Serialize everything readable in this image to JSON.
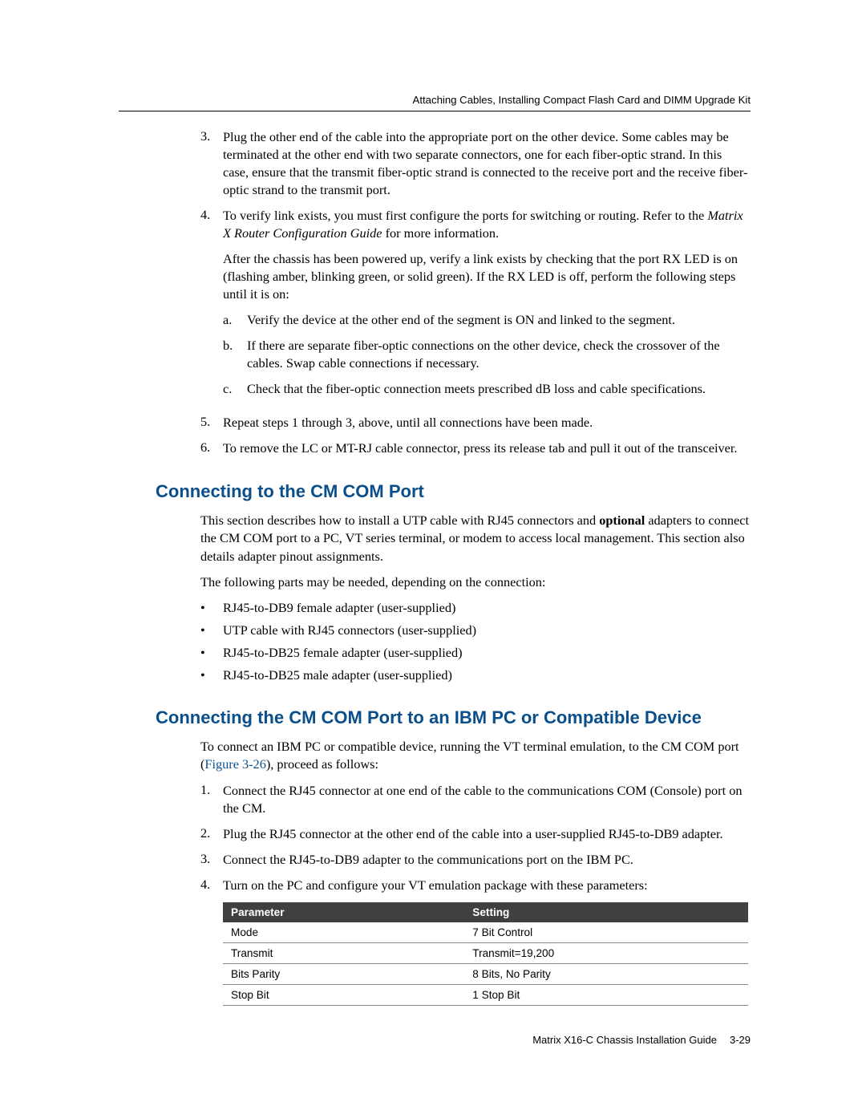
{
  "header": {
    "running_title": "Attaching Cables, Installing Compact Flash Card and DIMM Upgrade Kit"
  },
  "steps_first": {
    "i3": {
      "num": "3.",
      "text": "Plug the other end of the cable into the appropriate port on the other device. Some cables may be terminated at the other end with two separate connectors, one for each fiber-optic strand. In this case, ensure that the transmit fiber-optic strand is connected to the receive port and the receive fiber-optic strand to the transmit port."
    },
    "i4": {
      "num": "4.",
      "lead": "To verify link exists, you must first configure the ports for switching or routing. Refer to the ",
      "ital": "Matrix X Router Configuration Guide",
      "tail": " for more information.",
      "sub_para": "After the chassis has been powered up, verify a link exists by checking that the port RX LED is on (flashing amber, blinking green, or solid green). If the RX LED is off, perform the following steps until it is on:",
      "a": {
        "lbl": "a.",
        "text": "Verify the device at the other end of the segment is ON and linked to the segment."
      },
      "b": {
        "lbl": "b.",
        "text": "If there are separate fiber-optic connections on the other device, check the crossover of the cables. Swap cable connections if necessary."
      },
      "c": {
        "lbl": "c.",
        "text": "Check that the fiber-optic connection meets prescribed dB loss and cable specifications."
      }
    },
    "i5": {
      "num": "5.",
      "text": "Repeat steps 1 through 3, above, until all connections have been made."
    },
    "i6": {
      "num": "6.",
      "text": "To remove the LC or MT-RJ cable connector, press its release tab and pull it out of the transceiver."
    }
  },
  "section1": {
    "title": "Connecting to the CM COM Port",
    "para1_a": "This section describes how to install a UTP cable with RJ45 connectors and ",
    "para1_bold": "optional",
    "para1_b": " adapters to connect the CM COM port to a PC, VT series terminal, or modem to access local management. This section also details adapter pinout assignments.",
    "para2": "The following parts may be needed, depending on the connection:",
    "bullets": {
      "b1": "RJ45-to-DB9 female adapter (user-supplied)",
      "b2": "UTP cable with RJ45 connectors (user-supplied)",
      "b3": "RJ45-to-DB25 female adapter (user-supplied)",
      "b4": "RJ45-to-DB25 male adapter (user-supplied)"
    }
  },
  "section2": {
    "title": "Connecting the CM COM Port to an IBM PC or Compatible Device",
    "para1_a": "To connect an IBM PC or compatible device, running the VT terminal emulation, to the CM COM port (",
    "para1_link": "Figure 3-26",
    "para1_b": "), proceed as follows:",
    "steps": {
      "s1": {
        "num": "1.",
        "text": "Connect the RJ45 connector at one end of the cable to the communications COM (Console) port on the CM."
      },
      "s2": {
        "num": "2.",
        "text": "Plug the RJ45 connector at the other end of the cable into a user-supplied RJ45-to-DB9 adapter."
      },
      "s3": {
        "num": "3.",
        "text": "Connect the RJ45-to-DB9 adapter to the communications port on the IBM PC."
      },
      "s4": {
        "num": "4.",
        "text": "Turn on the PC and configure your VT emulation package with these parameters:"
      }
    }
  },
  "table": {
    "h1": "Parameter",
    "h2": "Setting",
    "r1c1": "Mode",
    "r1c2": "7 Bit Control",
    "r2c1": "Transmit",
    "r2c2": "Transmit=19,200",
    "r3c1": "Bits Parity",
    "r3c2": "8 Bits, No Parity",
    "r4c1": "Stop Bit",
    "r4c2": "1 Stop Bit"
  },
  "footer": {
    "doc": "Matrix X16-C Chassis Installation Guide",
    "page": "3-29"
  }
}
